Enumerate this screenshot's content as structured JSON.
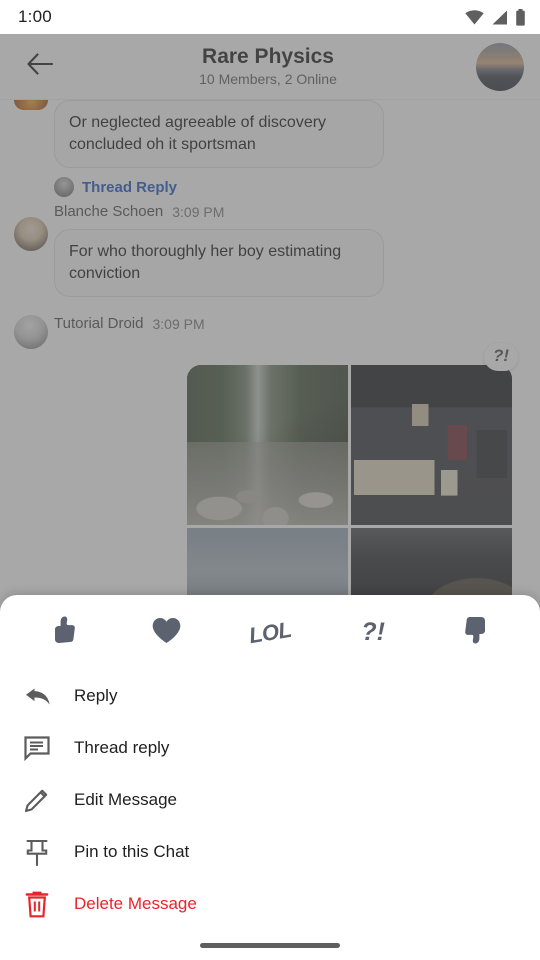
{
  "status_bar": {
    "clock": "1:00",
    "icons": [
      "wifi-icon",
      "cellular-signal-icon",
      "battery-icon"
    ]
  },
  "app_bar": {
    "back_icon": "arrow-back-icon",
    "title": "Rare Physics",
    "subtitle": "10 Members, 2 Online",
    "avatar": "user-avatar"
  },
  "messages": [
    {
      "id": "msg-1",
      "avatar": "av-orange",
      "text": "Or neglected agreeable of discovery concluded oh it sportsman",
      "thread_reply_label": "Thread Reply"
    },
    {
      "id": "msg-2",
      "avatar": "av-blanche",
      "sender": "Blanche Schoen",
      "time": "3:09 PM",
      "text": "For who thoroughly her boy estimating conviction"
    },
    {
      "id": "msg-3",
      "avatar": "av-droid",
      "sender": "Tutorial Droid",
      "time": "3:09 PM",
      "attachment_reaction": "?!",
      "images": [
        "waterfall-rocks-photo",
        "desk-setup-photo",
        "sky-horizon-photo",
        "dark-scene-photo"
      ]
    }
  ],
  "bottom_sheet": {
    "reactions": [
      {
        "name": "thumbs-up-reaction",
        "icon": "thumbs-up-icon",
        "label": ""
      },
      {
        "name": "heart-reaction",
        "icon": "heart-icon",
        "label": ""
      },
      {
        "name": "lol-reaction",
        "icon": "lol-text-icon",
        "label": "LOL"
      },
      {
        "name": "surprised-reaction",
        "icon": "interrobang-icon",
        "label": "?!"
      },
      {
        "name": "thumbs-down-reaction",
        "icon": "thumbs-down-icon",
        "label": ""
      }
    ],
    "menu_items": [
      {
        "name": "menu-item-reply",
        "icon": "reply-arrow-icon",
        "label": "Reply",
        "danger": false
      },
      {
        "name": "menu-item-thread-reply",
        "icon": "comment-icon",
        "label": "Thread reply",
        "danger": false
      },
      {
        "name": "menu-item-edit",
        "icon": "pencil-icon",
        "label": "Edit Message",
        "danger": false
      },
      {
        "name": "menu-item-pin",
        "icon": "pin-icon",
        "label": "Pin to this Chat",
        "danger": false
      },
      {
        "name": "menu-item-delete",
        "icon": "trash-icon",
        "label": "Delete Message",
        "danger": true
      }
    ]
  },
  "nav_bar": {
    "handle": "home-gesture-handle"
  },
  "colors": {
    "danger": "#e8242a",
    "link": "#1a56c4",
    "icon_grey": "#5c6270",
    "scrim": "rgba(100,100,100,0.56)"
  }
}
